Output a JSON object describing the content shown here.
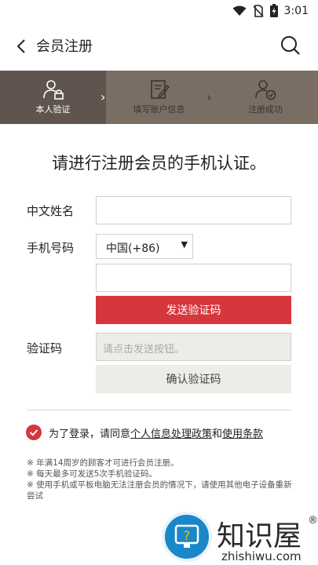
{
  "status_bar": {
    "time": "3:01"
  },
  "header": {
    "title": "会员注册"
  },
  "steps": [
    {
      "label": "本人验证"
    },
    {
      "label": "填写账户信息"
    },
    {
      "label": "注册成功"
    }
  ],
  "form": {
    "heading": "请进行注册会员的手机认证。",
    "name_label": "中文姓名",
    "name_value": "",
    "phone_label": "手机号码",
    "country_code": "中国(+86)",
    "phone_value": "",
    "send_button": "发送验证码",
    "code_label": "验证码",
    "code_placeholder": "请点击发送按钮。",
    "confirm_button": "确认验证码"
  },
  "agreement": {
    "prefix": "为了登录，请同意",
    "policy_link": "个人信息处理政策",
    "conjunction": "和",
    "terms_link": "使用条款",
    "checked": true
  },
  "notes": [
    "※ 年满14周岁的顾客才可进行会员注册。",
    "※ 每天最多可发送5次手机验证码。",
    "※ 使用手机或平板电脑无法注册会员的情况下，请使用其他电子设备重新尝试"
  ],
  "watermark": {
    "brand": "知识屋",
    "registered": "®",
    "url": "zhishiwu.com"
  },
  "colors": {
    "accent": "#d6373d",
    "steps_bar": "#7a6d63",
    "steps_active": "#5f554e"
  }
}
